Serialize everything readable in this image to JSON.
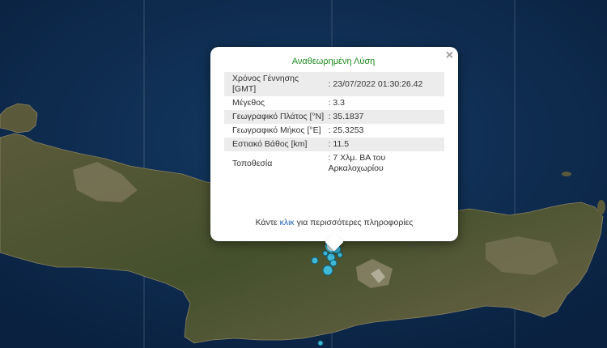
{
  "popup": {
    "title": "Αναθεωρημένη Λύση",
    "close_symbol": "×",
    "rows": [
      {
        "label": "Χρόνος Γέννησης [GMT]",
        "value": ": 23/07/2022 01:30:26.42"
      },
      {
        "label": "Μέγεθος",
        "value": ": 3.3"
      },
      {
        "label": "Γεωγραφικό Πλάτος [°N]",
        "value": ": 35.1837"
      },
      {
        "label": "Γεωγραφικό Μήκος [°E]",
        "value": ": 25.3253"
      },
      {
        "label": "Εστιακό Βάθος [km]",
        "value": ": 11.5"
      },
      {
        "label": "Τοποθεσία",
        "value": ": 7 Χλμ. ΒΑ του Αρκαλοχωρίου"
      }
    ],
    "more_prefix": "Κάντε ",
    "more_link": "κλικ",
    "more_suffix": " για περισσότερες πληροφορίες"
  },
  "map": {
    "colors": {
      "sea": "#0e2a4a",
      "land_dark": "#3f4a2a",
      "land_light": "#6a6a48",
      "marker": "#3fb8d6"
    }
  }
}
